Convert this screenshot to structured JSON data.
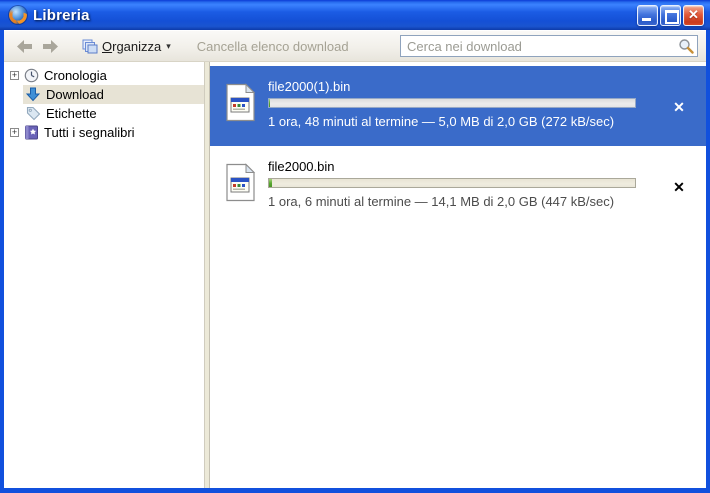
{
  "window": {
    "title": "Libreria",
    "controls": [
      {
        "name": "minimize"
      },
      {
        "name": "maximize"
      },
      {
        "name": "close"
      }
    ]
  },
  "toolbar": {
    "back": {
      "icon": "back-arrow-icon",
      "enabled": false
    },
    "forward": {
      "icon": "forward-arrow-icon",
      "enabled": false
    },
    "organize": {
      "icon": "stacked-pages-icon",
      "access_key": "O",
      "label_rest": "rganizza",
      "caret": "▾"
    },
    "clear_downloads_label": "Cancella elenco download",
    "search": {
      "placeholder": "Cerca nei download",
      "icon": "search-icon"
    }
  },
  "sidebar": {
    "items": [
      {
        "label": "Cronologia",
        "icon": "clock-icon",
        "expander": "+",
        "selected": false
      },
      {
        "label": "Download",
        "icon": "download-arrow-icon",
        "expander": null,
        "selected": true
      },
      {
        "label": "Etichette",
        "icon": "tag-icon",
        "expander": null,
        "selected": false
      },
      {
        "label": "Tutti i segnalibri",
        "icon": "bookmarks-book-icon",
        "expander": "+",
        "selected": false
      }
    ]
  },
  "downloads": {
    "items": [
      {
        "filename": "file2000(1).bin",
        "status": "1 ora, 48 minuti al termine — 5,0 MB di 2,0 GB (272 kB/sec)",
        "progress_percent": 0.25,
        "selected": true,
        "file_icon": "binary-file-icon",
        "cancel_icon": "cancel-x-icon"
      },
      {
        "filename": "file2000.bin",
        "status": "1 ora, 6 minuti al termine — 14,1 MB di 2,0 GB (447 kB/sec)",
        "progress_percent": 0.7,
        "selected": false,
        "file_icon": "binary-file-icon",
        "cancel_icon": "cancel-x-icon"
      }
    ]
  },
  "icons": {
    "expander_plus": "+",
    "cancel_glyph": "✕",
    "organize_caret": "▾"
  },
  "colors": {
    "titlebar_blue": "#1450d6",
    "window_border": "#1150dd",
    "selection_blue": "#3a6bc9",
    "sidebar_selected_bg": "#e7e3d5",
    "toolbar_bg": "#f2f0ea",
    "progress_fill_green": "#57a62f"
  }
}
